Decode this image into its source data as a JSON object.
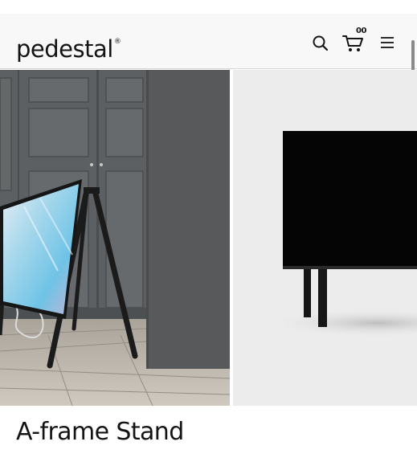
{
  "header": {
    "logo_text": "pedestal",
    "logo_mark": "®",
    "cart_count": "00",
    "icons": [
      "search-icon",
      "cart-icon",
      "menu-icon"
    ]
  },
  "product": {
    "title": "A-frame Stand"
  },
  "colors": {
    "text": "#141414",
    "header_bg": "#f8f8f8",
    "product_bg": "#ececec"
  }
}
